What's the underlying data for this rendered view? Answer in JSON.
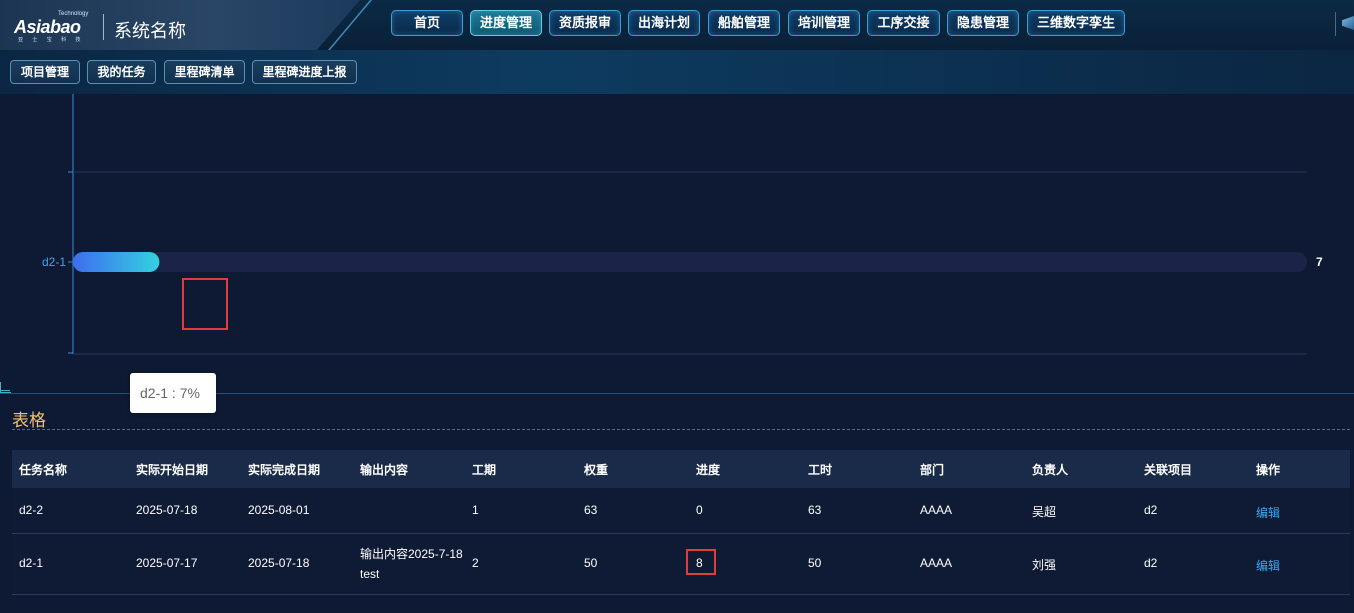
{
  "header": {
    "logo": {
      "tech": "Technology",
      "word": "Asiabao",
      "sub": "亚 士 宝 科 技"
    },
    "system_name": "系统名称",
    "nav": [
      "首页",
      "进度管理",
      "资质报审",
      "出海计划",
      "船舶管理",
      "培训管理",
      "工序交接",
      "隐患管理",
      "三维数字孪生"
    ],
    "active_nav": "进度管理"
  },
  "subnav": [
    "项目管理",
    "我的任务",
    "里程碑清单",
    "里程碑进度上报"
  ],
  "chart_data": {
    "type": "bar",
    "orientation": "horizontal",
    "categories": [
      "d2-1"
    ],
    "values": [
      7
    ],
    "xlim": [
      0,
      100
    ],
    "value_label": "7",
    "tooltip": "d2-1 : 7%",
    "colors": {
      "bar_start": "#3d6df0",
      "bar_end": "#34d1e0",
      "track": "#1b2348"
    }
  },
  "table": {
    "title": "表格",
    "columns": [
      "任务名称",
      "实际开始日期",
      "实际完成日期",
      "输出内容",
      "工期",
      "权重",
      "进度",
      "工时",
      "部门",
      "负责人",
      "关联项目",
      "操作"
    ],
    "rows": [
      [
        "d2-2",
        "2025-07-18",
        "2025-08-01",
        "",
        "1",
        "63",
        "0",
        "63",
        "AAAA",
        "吴超",
        "d2",
        "编辑"
      ],
      [
        "d2-1",
        "2025-07-17",
        "2025-07-18",
        "输出内容2025-7-18test",
        "2",
        "50",
        "8",
        "50",
        "AAAA",
        "刘强",
        "d2",
        "编辑"
      ]
    ]
  }
}
